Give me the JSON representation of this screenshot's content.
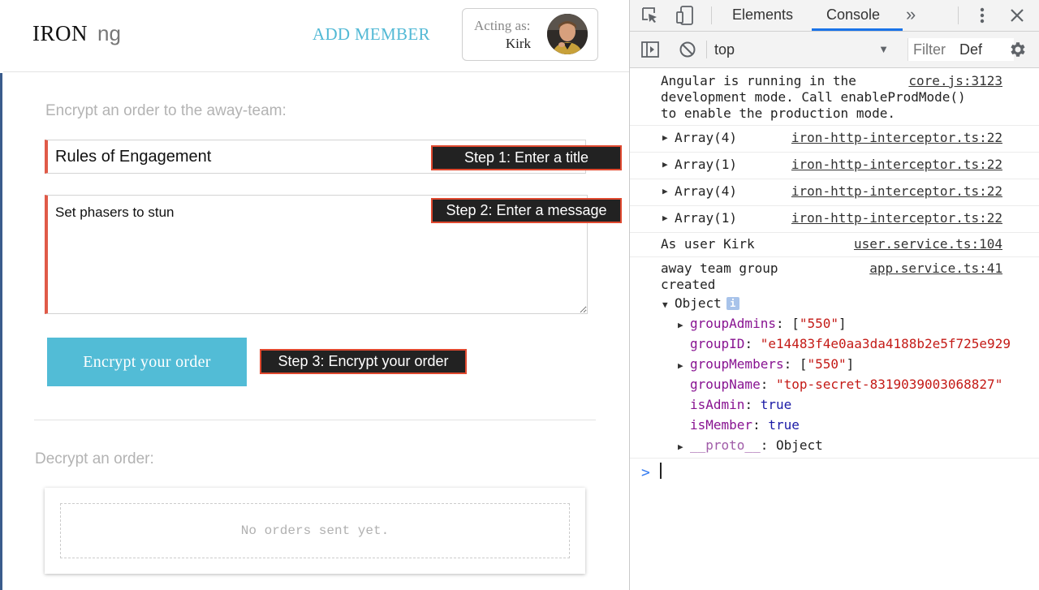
{
  "app": {
    "logo": {
      "brand": "IRON",
      "suffix": "ng"
    },
    "header": {
      "add_member_label": "ADD MEMBER",
      "acting_as_label": "Acting as:",
      "acting_user": "Kirk",
      "avatar_icon": "user-avatar"
    },
    "encrypt": {
      "section_title": "Encrypt an order to the away-team:",
      "title_value": "Rules of Engagement",
      "message_value": "Set phasers to stun",
      "button_label": "Encrypt your order"
    },
    "steps": {
      "step1": "Step 1: Enter a title",
      "step2": "Step 2: Enter a message",
      "step3": "Step 3: Encrypt your order"
    },
    "decrypt": {
      "section_title": "Decrypt an order:",
      "empty_text": "No orders sent yet."
    },
    "colors": {
      "accent": "#52bcd6",
      "input_border_left": "#e05a48",
      "step_border": "#e0492f"
    }
  },
  "devtools": {
    "tabs": [
      "Elements",
      "Console"
    ],
    "active_tab": "Console",
    "more_tabs_glyph": "»",
    "context": "top",
    "filter_placeholder": "Filter",
    "level": "Def",
    "messages": [
      {
        "text": "Angular is running in the\ndevelopment mode. Call enableProdMode()\nto enable the production mode.",
        "source": "core.js:3123"
      },
      {
        "text": "Array(4)",
        "source": "iron-http-interceptor.ts:22"
      },
      {
        "text": "Array(1)",
        "source": "iron-http-interceptor.ts:22"
      },
      {
        "text": "Array(4)",
        "source": "iron-http-interceptor.ts:22"
      },
      {
        "text": "Array(1)",
        "source": "iron-http-interceptor.ts:22"
      },
      {
        "text": "As user Kirk",
        "source": "user.service.ts:104"
      },
      {
        "text": "away team group\ncreated",
        "source": "app.service.ts:41"
      }
    ],
    "object": {
      "label": "Object",
      "info_badge": "i",
      "props": [
        {
          "key": "groupAdmins",
          "sep": ": [",
          "value": "\"550\"",
          "end": "]"
        },
        {
          "key": "groupID",
          "sep": ": ",
          "value": "\"e14483f4e0aa3da4188b2e5f725e929",
          "end": ""
        },
        {
          "key": "groupMembers",
          "sep": ": [",
          "value": "\"550\"",
          "end": "]"
        },
        {
          "key": "groupName",
          "sep": ": ",
          "value": "\"top-secret-8319039003068827\"",
          "end": ""
        },
        {
          "key": "isAdmin",
          "sep": ": ",
          "value": "true",
          "end": ""
        },
        {
          "key": "isMember",
          "sep": ": ",
          "value": "true",
          "end": ""
        },
        {
          "key": "__proto__",
          "sep": ": ",
          "value": "Object",
          "end": ""
        }
      ]
    },
    "prompt_glyph": ">"
  }
}
